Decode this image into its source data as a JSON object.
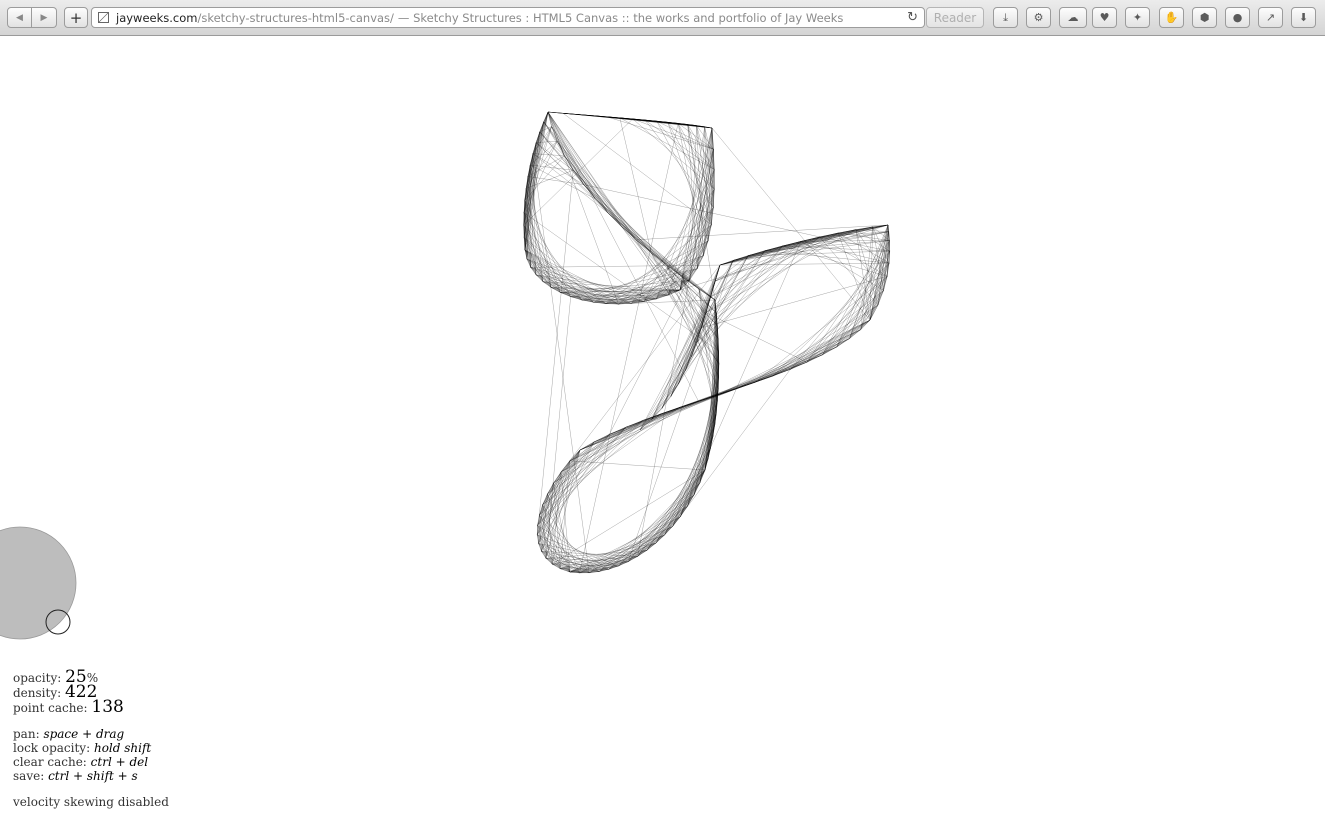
{
  "browser": {
    "url_domain": "jayweeks.com",
    "url_path": "/sketchy-structures-html5-canvas/",
    "page_title": "— Sketchy Structures : HTML5 Canvas :: the works and portfolio of Jay Weeks",
    "reader_label": "Reader",
    "toolbar_icons": [
      "download-icon",
      "gear-icon",
      "cloud-icon",
      "pocket-icon",
      "wand-icon",
      "puzzle-icon",
      "shield-icon",
      "lightbulb-icon",
      "share-icon",
      "downloads-icon"
    ]
  },
  "hud": {
    "opacity_label": "opacity:",
    "opacity_value": "25",
    "opacity_unit": "%",
    "density_label": "density:",
    "density_value": "422",
    "cache_label": "point cache:",
    "cache_value": "138",
    "pan_label": "pan:",
    "pan_keys": "space + drag",
    "lock_label": "lock opacity:",
    "lock_keys": "hold shift",
    "clear_label": "clear cache:",
    "clear_keys": "ctrl + del",
    "save_label": "save:",
    "save_keys": "ctrl + shift + s",
    "status": "velocity skewing disabled"
  },
  "colors": {
    "brush": "#bdbdbd",
    "stroke": "#000000"
  }
}
